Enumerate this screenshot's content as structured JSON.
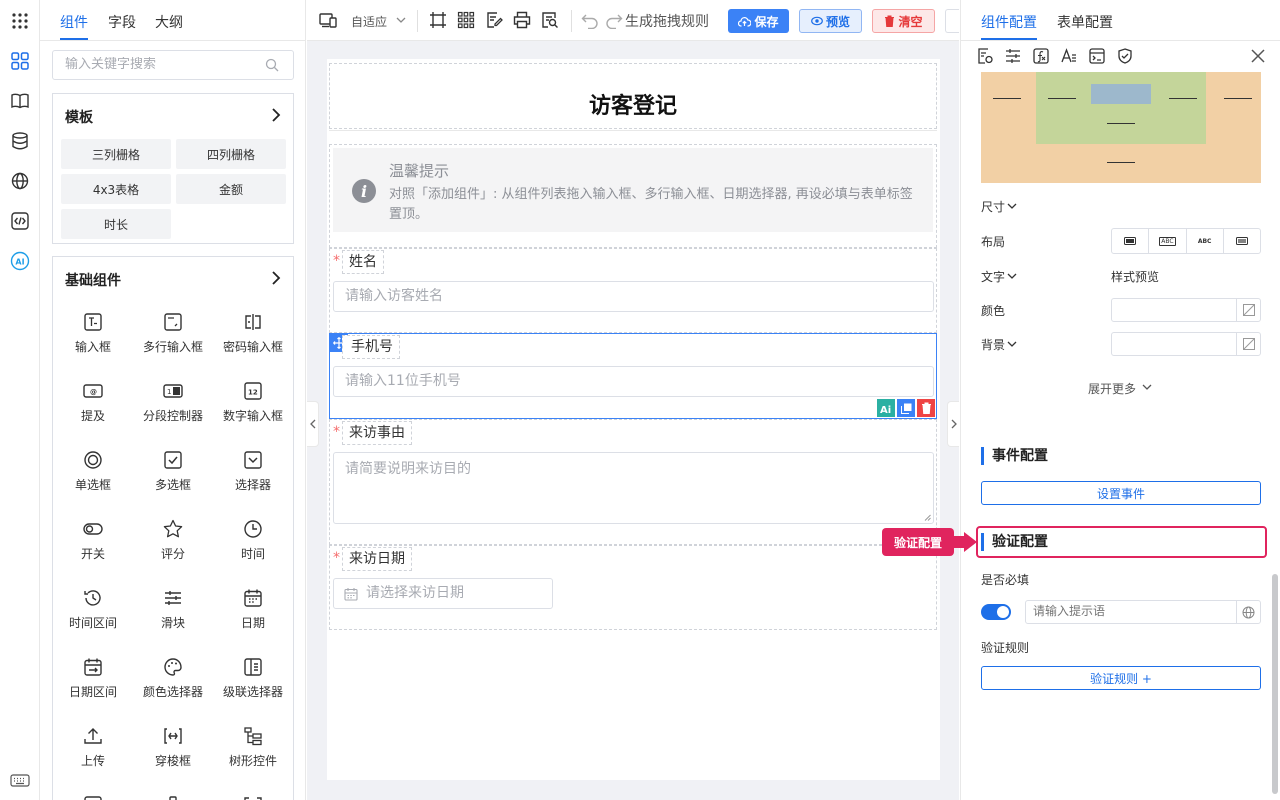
{
  "left_panel": {
    "tabs": [
      {
        "label": "组件"
      },
      {
        "label": "字段"
      },
      {
        "label": "大纲"
      }
    ],
    "search_placeholder": "输入关键字搜索",
    "templates": {
      "title": "模板",
      "items": [
        {
          "label": "三列栅格"
        },
        {
          "label": "四列栅格"
        },
        {
          "label": "4x3表格"
        },
        {
          "label": "金额"
        },
        {
          "label": "时长"
        }
      ]
    },
    "basic": {
      "title": "基础组件",
      "items": [
        {
          "label": "输入框"
        },
        {
          "label": "多行输入框"
        },
        {
          "label": "密码输入框"
        },
        {
          "label": "提及"
        },
        {
          "label": "分段控制器"
        },
        {
          "label": "数字输入框"
        },
        {
          "label": "单选框"
        },
        {
          "label": "多选框"
        },
        {
          "label": "选择器"
        },
        {
          "label": "开关"
        },
        {
          "label": "评分"
        },
        {
          "label": "时间"
        },
        {
          "label": "时间区间"
        },
        {
          "label": "滑块"
        },
        {
          "label": "日期"
        },
        {
          "label": "日期区间"
        },
        {
          "label": "颜色选择器"
        },
        {
          "label": "级联选择器"
        },
        {
          "label": "上传"
        },
        {
          "label": "穿梭框"
        },
        {
          "label": "树形控件"
        }
      ]
    }
  },
  "toolbar": {
    "adaptive": "自适应",
    "undo_redo_text": "生成拖拽规则",
    "save": "保存",
    "preview": "预览",
    "clear": "清空"
  },
  "form": {
    "title": "访客登记",
    "tip": {
      "title": "温馨提示",
      "text": "对照「添加组件」: 从组件列表拖入输入框、多行输入框、日期选择器, 再设必填与表单标签置顶。"
    },
    "fields": {
      "name": {
        "label": "姓名",
        "placeholder": "请输入访客姓名"
      },
      "phone": {
        "label": "手机号",
        "placeholder": "请输入11位手机号"
      },
      "reason": {
        "label": "来访事由",
        "placeholder": "请简要说明来访目的"
      },
      "date": {
        "label": "来访日期",
        "placeholder": "请选择来访日期"
      }
    }
  },
  "right_panel": {
    "tabs": [
      {
        "label": "组件配置"
      },
      {
        "label": "表单配置"
      }
    ],
    "size_label": "尺寸",
    "layout_label": "布局",
    "text_label": "文字",
    "style_preview": "样式预览",
    "color_label": "颜色",
    "bg_label": "背景",
    "expand_more": "展开更多",
    "event_section": "事件配置",
    "set_event": "设置事件",
    "validate_section": "验证配置",
    "callout": "验证配置",
    "required_label": "是否必填",
    "required_placeholder": "请输入提示语",
    "rules_label": "验证规则",
    "rules_button": "验证规则 +",
    "layout_options": [
      "ABC",
      "ABC"
    ]
  },
  "colors": {
    "accent": "#1e6fe8",
    "danger": "#f56c6c",
    "callout": "#e0245e",
    "margin_box": "#f2d0a5",
    "padding_box": "#c4d59a",
    "content_box": "#9db8cc"
  }
}
